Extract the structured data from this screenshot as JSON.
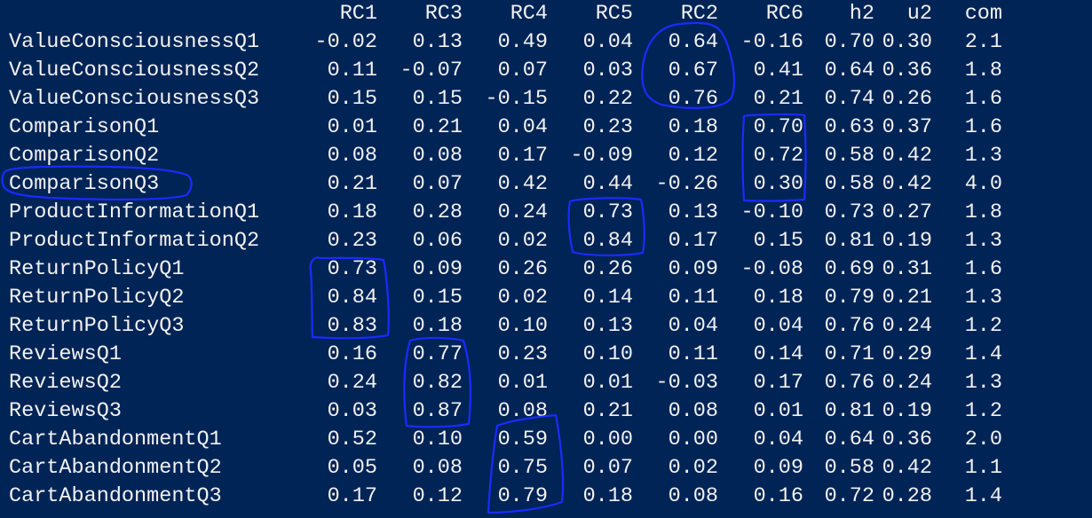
{
  "theme": {
    "background": "#012456",
    "text": "#f2f2f2",
    "annotation": "#1a2bff"
  },
  "table": {
    "columns": [
      "RC1",
      "RC3",
      "RC4",
      "RC5",
      "RC2",
      "RC6",
      "h2",
      "u2",
      "com"
    ],
    "rows": [
      {
        "label": "ValueConsciousnessQ1",
        "values": [
          "-0.02",
          "0.13",
          "0.49",
          "0.04",
          "0.64",
          "-0.16",
          "0.70",
          "0.30",
          "2.1"
        ]
      },
      {
        "label": "ValueConsciousnessQ2",
        "values": [
          "0.11",
          "-0.07",
          "0.07",
          "0.03",
          "0.67",
          "0.41",
          "0.64",
          "0.36",
          "1.8"
        ]
      },
      {
        "label": "ValueConsciousnessQ3",
        "values": [
          "0.15",
          "0.15",
          "-0.15",
          "0.22",
          "0.76",
          "0.21",
          "0.74",
          "0.26",
          "1.6"
        ]
      },
      {
        "label": "ComparisonQ1",
        "values": [
          "0.01",
          "0.21",
          "0.04",
          "0.23",
          "0.18",
          "0.70",
          "0.63",
          "0.37",
          "1.6"
        ]
      },
      {
        "label": "ComparisonQ2",
        "values": [
          "0.08",
          "0.08",
          "0.17",
          "-0.09",
          "0.12",
          "0.72",
          "0.58",
          "0.42",
          "1.3"
        ]
      },
      {
        "label": "ComparisonQ3",
        "values": [
          "0.21",
          "0.07",
          "0.42",
          "0.44",
          "-0.26",
          "0.30",
          "0.58",
          "0.42",
          "4.0"
        ]
      },
      {
        "label": "ProductInformationQ1",
        "values": [
          "0.18",
          "0.28",
          "0.24",
          "0.73",
          "0.13",
          "-0.10",
          "0.73",
          "0.27",
          "1.8"
        ]
      },
      {
        "label": "ProductInformationQ2",
        "values": [
          "0.23",
          "0.06",
          "0.02",
          "0.84",
          "0.17",
          "0.15",
          "0.81",
          "0.19",
          "1.3"
        ]
      },
      {
        "label": "ReturnPolicyQ1",
        "values": [
          "0.73",
          "0.09",
          "0.26",
          "0.26",
          "0.09",
          "-0.08",
          "0.69",
          "0.31",
          "1.6"
        ]
      },
      {
        "label": "ReturnPolicyQ2",
        "values": [
          "0.84",
          "0.15",
          "0.02",
          "0.14",
          "0.11",
          "0.18",
          "0.79",
          "0.21",
          "1.3"
        ]
      },
      {
        "label": "ReturnPolicyQ3",
        "values": [
          "0.83",
          "0.18",
          "0.10",
          "0.13",
          "0.04",
          "0.04",
          "0.76",
          "0.24",
          "1.2"
        ]
      },
      {
        "label": "ReviewsQ1",
        "values": [
          "0.16",
          "0.77",
          "0.23",
          "0.10",
          "0.11",
          "0.14",
          "0.71",
          "0.29",
          "1.4"
        ]
      },
      {
        "label": "ReviewsQ2",
        "values": [
          "0.24",
          "0.82",
          "0.01",
          "0.01",
          "-0.03",
          "0.17",
          "0.76",
          "0.24",
          "1.3"
        ]
      },
      {
        "label": "ReviewsQ3",
        "values": [
          "0.03",
          "0.87",
          "0.08",
          "0.21",
          "0.08",
          "0.01",
          "0.81",
          "0.19",
          "1.2"
        ]
      },
      {
        "label": "CartAbandonmentQ1",
        "values": [
          "0.52",
          "0.10",
          "0.59",
          "0.00",
          "0.00",
          "0.04",
          "0.64",
          "0.36",
          "2.0"
        ]
      },
      {
        "label": "CartAbandonmentQ2",
        "values": [
          "0.05",
          "0.08",
          "0.75",
          "0.07",
          "0.02",
          "0.09",
          "0.58",
          "0.42",
          "1.1"
        ]
      },
      {
        "label": "CartAbandonmentQ3",
        "values": [
          "0.17",
          "0.12",
          "0.79",
          "0.18",
          "0.08",
          "0.16",
          "0.72",
          "0.28",
          "1.4"
        ]
      }
    ]
  }
}
